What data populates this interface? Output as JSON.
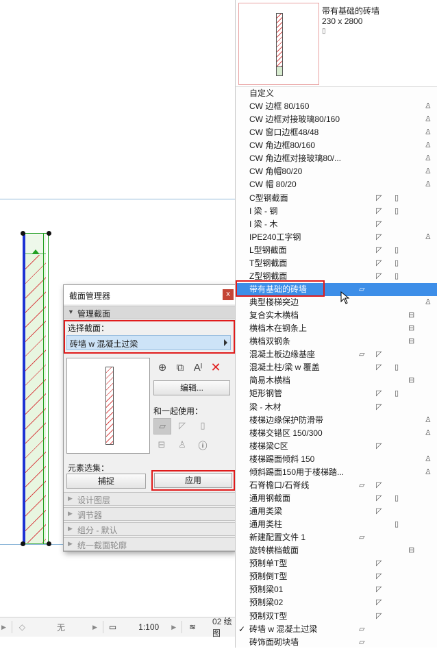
{
  "status_bar": {
    "layer_icon": "layer-icon",
    "layer_label": "无",
    "scale_icon": "ruler-icon",
    "scale_label": "1:100",
    "layers_icon": "stack-icon",
    "view_label": "02 绘图"
  },
  "dialog": {
    "title": "截面管理器",
    "close": "x",
    "section_manage": "管理截面",
    "select_label": "选择截面：",
    "selected_profile": "砖墙 w 混凝土过梁",
    "edit_button": "编辑...",
    "use_with_label": "和一起使用：",
    "element_set_label": "元素选集：",
    "capture_button": "捕捉",
    "apply_button": "应用",
    "collapsed_sections": [
      "设计图层",
      "调节器",
      "组分 - 默认",
      "统一截面轮廓"
    ],
    "toolbar_icons": [
      "new-profile-icon",
      "duplicate-profile-icon",
      "rename-icon",
      "delete-icon"
    ]
  },
  "panel": {
    "preview_name": "带有基础的砖墙",
    "preview_size": "230 x 2800",
    "preview_glyph": "▯",
    "items": [
      {
        "label": "自定义",
        "icons": [
          "",
          "",
          "",
          "",
          ""
        ]
      },
      {
        "label": "CW 边框 80/160",
        "icons": [
          "",
          "",
          "",
          "",
          "♙"
        ]
      },
      {
        "label": "CW 边框对接玻璃80/160",
        "icons": [
          "",
          "",
          "",
          "",
          "♙"
        ]
      },
      {
        "label": "CW 窗口边框48/48",
        "icons": [
          "",
          "",
          "",
          "",
          "♙"
        ]
      },
      {
        "label": "CW 角边框80/160",
        "icons": [
          "",
          "",
          "",
          "",
          "♙"
        ]
      },
      {
        "label": "CW 角边框对接玻璃80/...",
        "icons": [
          "",
          "",
          "",
          "",
          "♙"
        ]
      },
      {
        "label": "CW 角帽80/20",
        "icons": [
          "",
          "",
          "",
          "",
          "♙"
        ]
      },
      {
        "label": "CW 帽 80/20",
        "icons": [
          "",
          "",
          "",
          "",
          "♙"
        ]
      },
      {
        "label": "C型钢截面",
        "icons": [
          "",
          "◸",
          "▯",
          "",
          ""
        ]
      },
      {
        "label": "I 梁 - 钢",
        "icons": [
          "",
          "◸",
          "▯",
          "",
          ""
        ]
      },
      {
        "label": "I 梁 - 木",
        "icons": [
          "",
          "◸",
          "",
          "",
          ""
        ]
      },
      {
        "label": "IPE240工字钢",
        "icons": [
          "",
          "◸",
          "",
          "",
          "♙"
        ]
      },
      {
        "label": "L型钢截面",
        "icons": [
          "",
          "◸",
          "▯",
          "",
          ""
        ]
      },
      {
        "label": "T型钢截面",
        "icons": [
          "",
          "◸",
          "▯",
          "",
          ""
        ]
      },
      {
        "label": "Z型钢截面",
        "icons": [
          "",
          "◸",
          "▯",
          "",
          ""
        ]
      },
      {
        "label": "带有基础的砖墙",
        "icons": [
          "▱",
          "",
          "",
          "",
          ""
        ]
      },
      {
        "label": "典型楼梯突边",
        "icons": [
          "",
          "",
          "",
          "",
          "♙"
        ]
      },
      {
        "label": "复合实木横档",
        "icons": [
          "",
          "",
          "",
          "⊟",
          ""
        ]
      },
      {
        "label": "横档木在钢条上",
        "icons": [
          "",
          "",
          "",
          "⊟",
          ""
        ]
      },
      {
        "label": "横档双钢条",
        "icons": [
          "",
          "",
          "",
          "⊟",
          ""
        ]
      },
      {
        "label": "混凝土板边缘基座",
        "icons": [
          "▱",
          "◸",
          "",
          "",
          ""
        ]
      },
      {
        "label": "混凝土柱/梁 w 覆盖",
        "icons": [
          "",
          "◸",
          "▯",
          "",
          ""
        ]
      },
      {
        "label": "简易木横档",
        "icons": [
          "",
          "",
          "",
          "⊟",
          ""
        ]
      },
      {
        "label": "矩形钢管",
        "icons": [
          "",
          "◸",
          "▯",
          "",
          ""
        ]
      },
      {
        "label": "梁 - 木材",
        "icons": [
          "",
          "◸",
          "",
          "",
          ""
        ]
      },
      {
        "label": "楼梯边缘保护防滑带",
        "icons": [
          "",
          "",
          "",
          "",
          "♙"
        ]
      },
      {
        "label": "楼梯交错区 150/300",
        "icons": [
          "",
          "",
          "",
          "",
          "♙"
        ]
      },
      {
        "label": "楼梯梁C区",
        "icons": [
          "",
          "◸",
          "",
          "",
          ""
        ]
      },
      {
        "label": "楼梯踢面倾斜 150",
        "icons": [
          "",
          "",
          "",
          "",
          "♙"
        ]
      },
      {
        "label": "倾斜踢面150用于楼梯踏...",
        "icons": [
          "",
          "",
          "",
          "",
          "♙"
        ]
      },
      {
        "label": "石脊檐口/石脊线",
        "icons": [
          "▱",
          "◸",
          "",
          "",
          ""
        ]
      },
      {
        "label": "通用钢截面",
        "icons": [
          "",
          "◸",
          "▯",
          "",
          ""
        ]
      },
      {
        "label": "通用类梁",
        "icons": [
          "",
          "◸",
          "",
          "",
          ""
        ]
      },
      {
        "label": "通用类柱",
        "icons": [
          "",
          "",
          "▯",
          "",
          ""
        ]
      },
      {
        "label": "新建配置文件 1",
        "icons": [
          "▱",
          "",
          "",
          "",
          ""
        ]
      },
      {
        "label": "旋转横档截面",
        "icons": [
          "",
          "",
          "",
          "⊟",
          ""
        ]
      },
      {
        "label": "预制单T型",
        "icons": [
          "",
          "◸",
          "",
          "",
          ""
        ]
      },
      {
        "label": "预制倒T型",
        "icons": [
          "",
          "◸",
          "",
          "",
          ""
        ]
      },
      {
        "label": "预制梁01",
        "icons": [
          "",
          "◸",
          "",
          "",
          ""
        ]
      },
      {
        "label": "预制梁02",
        "icons": [
          "",
          "◸",
          "",
          "",
          ""
        ]
      },
      {
        "label": "预制双T型",
        "icons": [
          "",
          "◸",
          "",
          "",
          ""
        ]
      },
      {
        "label": "砖墙 w 混凝土过梁",
        "icons": [
          "",
          "",
          "",
          "",
          ""
        ],
        "checked": "✓",
        "icon_b": "▱"
      },
      {
        "label": "砖饰面砌块墙",
        "icons": [
          "",
          "",
          "",
          "",
          ""
        ],
        "icon_b": "▱"
      }
    ],
    "highlighted_index": 15
  }
}
